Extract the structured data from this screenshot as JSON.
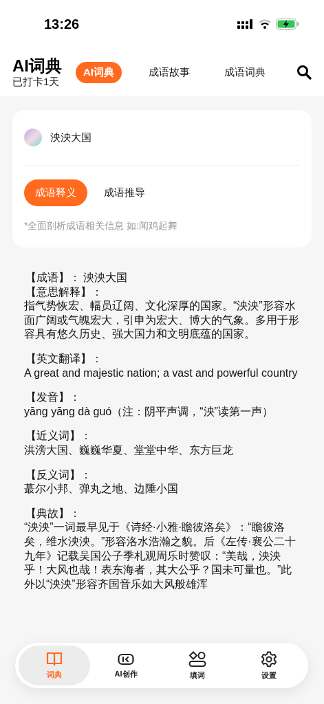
{
  "status_bar": {
    "time": "13:26"
  },
  "header": {
    "title": "AI词典",
    "subtitle": "已打卡1天",
    "tabs": [
      {
        "label": "AI词典",
        "selected": true
      },
      {
        "label": "成语故事",
        "selected": false
      },
      {
        "label": "成语词典",
        "selected": false
      }
    ]
  },
  "query_card": {
    "query": "泱泱大国",
    "modes": [
      {
        "label": "成语释义",
        "selected": true
      },
      {
        "label": "成语推导",
        "selected": false
      }
    ],
    "hint": "*全面剖析成语相关信息 如:闻鸡起舞"
  },
  "result": [
    {
      "kind": "term",
      "text": "【成语】： 泱泱大国"
    },
    {
      "kind": "section",
      "heading": "【意思解释】：",
      "body": "指气势恢宏、幅员辽阔、文化深厚的国家。“泱泱”形容水面广阔或气魄宏大，引申为宏大、博大的气象。多用于形容具有悠久历史、强大国力和文明底蕴的国家。"
    },
    {
      "kind": "section",
      "heading": "【英文翻译】：",
      "body": "A great and majestic nation; a vast and powerful country"
    },
    {
      "kind": "section",
      "heading": "【发音】：",
      "body": "yāng yāng dà guó（注：阴平声调，“泱”读第一声）"
    },
    {
      "kind": "section",
      "heading": "【近义词】：",
      "body": "洪滂大国、巍巍华夏、堂堂中华、东方巨龙"
    },
    {
      "kind": "section",
      "heading": "【反义词】：",
      "body": "蕞尔小邦、弹丸之地、边陲小国"
    },
    {
      "kind": "section",
      "heading": "【典故】：",
      "body": "“泱泱”一词最早见于《诗经·小雅·瞻彼洛矣》：“瞻彼洛矣，维水泱泱。”形容洛水浩瀚之貌。后《左传·襄公二十九年》记载吴国公子季札观周乐时赞叹：“美哉，泱泱乎！大风也哉！表东海者，其大公乎？国未可量也。”此外以“泱泱”形容齐国音乐如大风般雄浑"
    }
  ],
  "tab_bar": [
    {
      "label": "词典",
      "selected": true
    },
    {
      "label": "AI创作",
      "selected": false
    },
    {
      "label": "填词",
      "selected": false
    },
    {
      "label": "设置",
      "selected": false
    }
  ]
}
